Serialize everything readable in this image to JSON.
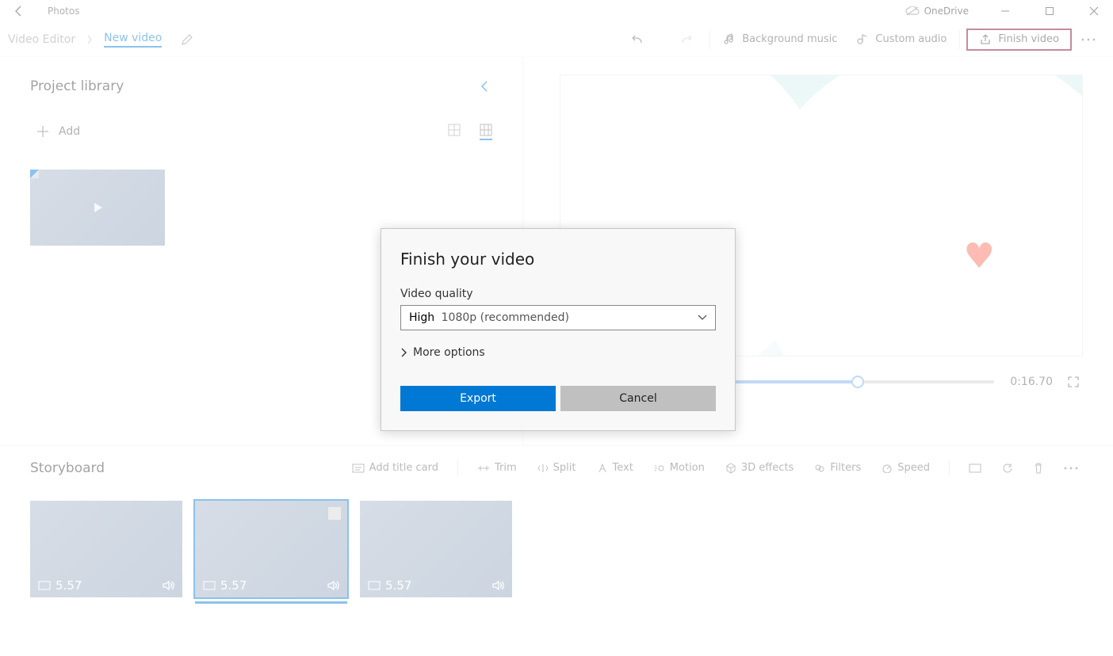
{
  "app": {
    "title": "Photos"
  },
  "cloud": {
    "label": "OneDrive"
  },
  "breadcrumb": {
    "root": "Video Editor",
    "project": "New video"
  },
  "toolbar": {
    "bg_music": "Background music",
    "custom_audio": "Custom audio",
    "finish": "Finish video"
  },
  "library": {
    "title": "Project library",
    "add": "Add"
  },
  "preview": {
    "timecode": "0:16.70"
  },
  "storyboard": {
    "title": "Storyboard",
    "tools": {
      "title_card": "Add title card",
      "trim": "Trim",
      "split": "Split",
      "text": "Text",
      "motion": "Motion",
      "effects3d": "3D effects",
      "filters": "Filters",
      "speed": "Speed"
    },
    "clips": [
      {
        "duration": "5.57"
      },
      {
        "duration": "5.57"
      },
      {
        "duration": "5.57"
      }
    ]
  },
  "dialog": {
    "title": "Finish your video",
    "quality_label": "Video quality",
    "quality_hi": "High",
    "quality_rest": "1080p (recommended)",
    "more": "More options",
    "export": "Export",
    "cancel": "Cancel"
  }
}
